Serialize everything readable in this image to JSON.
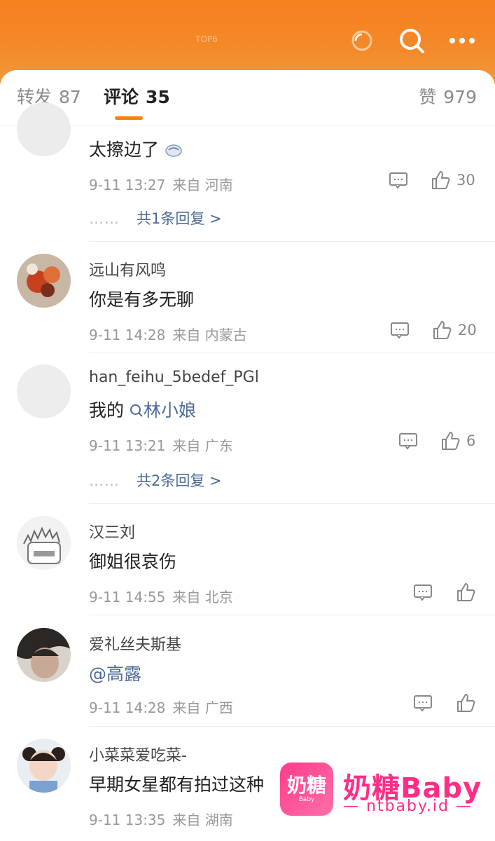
{
  "header": {
    "center_tag": "TOP6",
    "icons": [
      "refresh-icon",
      "search-icon",
      "more-icon"
    ]
  },
  "tabs": {
    "forward": {
      "label": "转发",
      "count": "87"
    },
    "comments": {
      "label": "评论",
      "count": "35"
    },
    "likes": {
      "label": "赞",
      "count": "979"
    }
  },
  "comments": [
    {
      "user": "",
      "text": "太擦边了",
      "emoji": "sweat-emoji",
      "time": "9-11 13:27",
      "source": "来自 河南",
      "likes": "30",
      "replies": "共1条回复 >"
    },
    {
      "user": "远山有风鸣",
      "text": "你是有多无聊",
      "time": "9-11 14:28",
      "source": "来自 内蒙古",
      "likes": "20"
    },
    {
      "user": "han_feihu_5bedef_PGl",
      "text_prefix": "我的",
      "text_link": "林小娘",
      "time": "9-11 13:21",
      "source": "来自 广东",
      "likes": "6",
      "replies": "共2条回复 >"
    },
    {
      "user": "汉三刘",
      "text": "御姐很哀伤",
      "time": "9-11 14:55",
      "source": "来自 北京",
      "likes": ""
    },
    {
      "user": "爱礼丝夫斯基",
      "text": "@高露",
      "time": "9-11 14:28",
      "source": "来自 广西",
      "likes": ""
    },
    {
      "user": "小菜菜爱吃菜-",
      "text": "早期女星都有拍过这种",
      "time": "9-11 13:35",
      "source": "来自 湖南"
    }
  ],
  "reply_dots": "……",
  "watermark": {
    "logo_text": "奶糖",
    "logo_sub": "Baby",
    "title": "奶糖Baby",
    "url": "— ntbaby.id —"
  },
  "colors": {
    "header": "#f7801f",
    "accent": "#ff8200",
    "link": "#4d6a98",
    "watermark": "#ff2d86"
  }
}
